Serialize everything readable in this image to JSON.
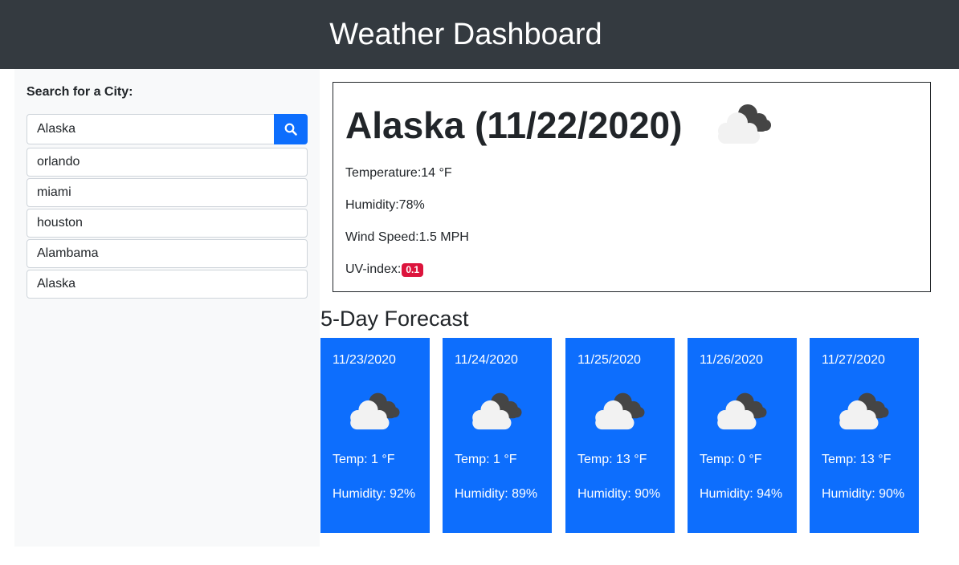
{
  "header": {
    "title": "Weather Dashboard"
  },
  "search": {
    "label": "Search for a City:",
    "value": "Alaska",
    "button_icon": "search-icon"
  },
  "history": [
    "orlando",
    "miami",
    "houston",
    "Alambama",
    "Alaska"
  ],
  "current": {
    "title": "Alaska (11/22/2020)",
    "icon": "cloudy-icon",
    "temperature": "Temperature:14 °F",
    "humidity": "Humidity:78%",
    "wind": "Wind Speed:1.5 MPH",
    "uv_label": "UV-index:",
    "uv_value": "0.1"
  },
  "forecast_title": "5-Day Forecast",
  "forecast": [
    {
      "date": "11/23/2020",
      "temp": "Temp: 1 °F",
      "humidity": "Humidity: 92%"
    },
    {
      "date": "11/24/2020",
      "temp": "Temp: 1 °F",
      "humidity": "Humidity: 89%"
    },
    {
      "date": "11/25/2020",
      "temp": "Temp: 13 °F",
      "humidity": "Humidity: 90%"
    },
    {
      "date": "11/26/2020",
      "temp": "Temp: 0 °F",
      "humidity": "Humidity: 94%"
    },
    {
      "date": "11/27/2020",
      "temp": "Temp: 13 °F",
      "humidity": "Humidity: 90%"
    }
  ],
  "colors": {
    "navbar": "#343a40",
    "primary": "#0d6efd",
    "uv_badge": "#dc143c",
    "sidebar": "#f8f9fa"
  }
}
